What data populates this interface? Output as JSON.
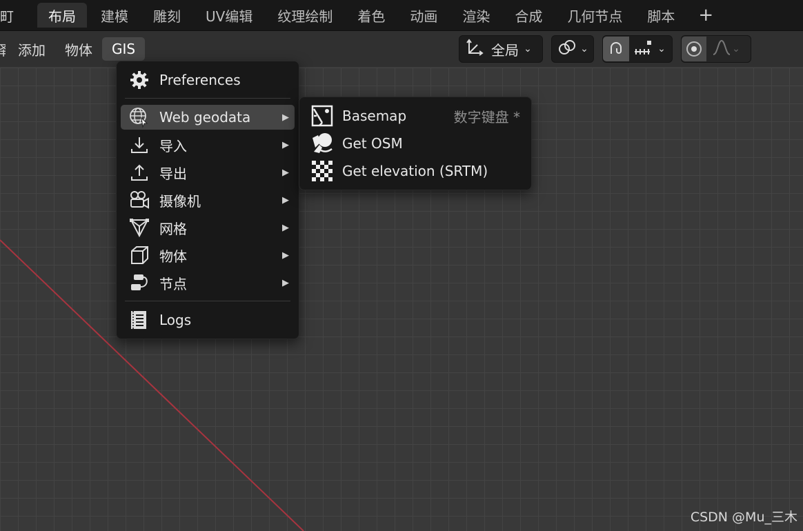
{
  "topbar": {
    "left_edge": "町",
    "tabs": [
      "布局",
      "建模",
      "雕刻",
      "UV编辑",
      "纹理绘制",
      "着色",
      "动画",
      "渲染",
      "合成",
      "几何节点",
      "脚本"
    ],
    "active_tab": "布局",
    "add_tab": "+"
  },
  "header": {
    "left_edge": "择",
    "menus": [
      "添加",
      "物体",
      "GIS"
    ],
    "open_menu": "GIS",
    "transform_orientation": "全局"
  },
  "gis_menu": {
    "preferences": "Preferences",
    "web_geodata": "Web geodata",
    "import": "导入",
    "export": "导出",
    "camera": "摄像机",
    "mesh": "网格",
    "object": "物体",
    "nodes": "节点",
    "logs": "Logs"
  },
  "web_geodata_menu": {
    "basemap": "Basemap",
    "basemap_shortcut": "数字键盘 *",
    "get_osm": "Get OSM",
    "get_elevation": "Get elevation (SRTM)"
  },
  "watermark": "CSDN @Mu_三木",
  "colors": {
    "background": "#393939",
    "menu_bg": "#181818",
    "highlight": "#454545",
    "x_axis": "#a8343f"
  }
}
